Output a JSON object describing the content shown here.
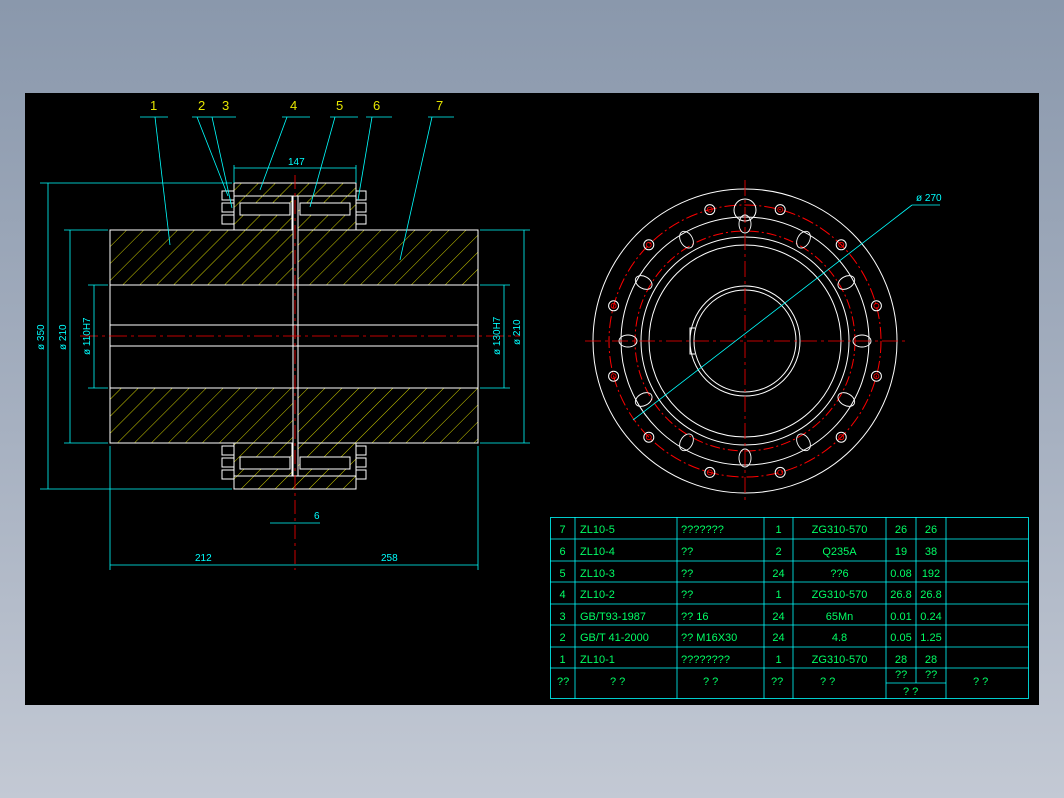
{
  "colors": {
    "background": "#000000",
    "outline": "#ffffff",
    "hatch": "#e6e600",
    "dimension": "#00ffff",
    "centerline": "#ff0000",
    "leader": "#00ffff",
    "bolt": "#ff0000"
  },
  "balloons": [
    "1",
    "2",
    "3",
    "4",
    "5",
    "6",
    "7"
  ],
  "dimensions": {
    "flange_width": "147",
    "outer_dia": "ø 350",
    "hub_dia_left": "ø 210",
    "bore_left": "ø 110H7",
    "bore_right": "ø 130H7",
    "hub_dia_right": "ø 210",
    "gap": "6",
    "left_length": "212",
    "right_length": "258",
    "bolt_circle": "ø 270"
  },
  "bom": {
    "rows": [
      {
        "no": "7",
        "code": "ZL10-5",
        "name": "???????",
        "qty": "1",
        "material": "ZG310-570",
        "unit": "26",
        "total": "26"
      },
      {
        "no": "6",
        "code": "ZL10-4",
        "name": "??",
        "qty": "2",
        "material": "Q235A",
        "unit": "19",
        "total": "38"
      },
      {
        "no": "5",
        "code": "ZL10-3",
        "name": "??",
        "qty": "24",
        "material": "??6",
        "unit": "0.08",
        "total": "192"
      },
      {
        "no": "4",
        "code": "ZL10-2",
        "name": "??",
        "qty": "1",
        "material": "ZG310-570",
        "unit": "26.8",
        "total": "26.8"
      },
      {
        "no": "3",
        "code": "GB/T93-1987",
        "name": "?? 16",
        "qty": "24",
        "material": "65Mn",
        "unit": "0.01",
        "total": "0.24"
      },
      {
        "no": "2",
        "code": "GB/T 41-2000",
        "name": "?? M16X30",
        "qty": "24",
        "material": "4.8",
        "unit": "0.05",
        "total": "1.25"
      },
      {
        "no": "1",
        "code": "ZL10-1",
        "name": "????????",
        "qty": "1",
        "material": "ZG310-570",
        "unit": "28",
        "total": "28"
      }
    ],
    "header": {
      "no": "??",
      "code": "?  ?",
      "name": "?  ?",
      "qty": "??",
      "material": "?  ?",
      "weight_top_a": "??",
      "weight_top_b": "??",
      "weight_bottom": "?  ?",
      "remark": "?  ?"
    }
  }
}
